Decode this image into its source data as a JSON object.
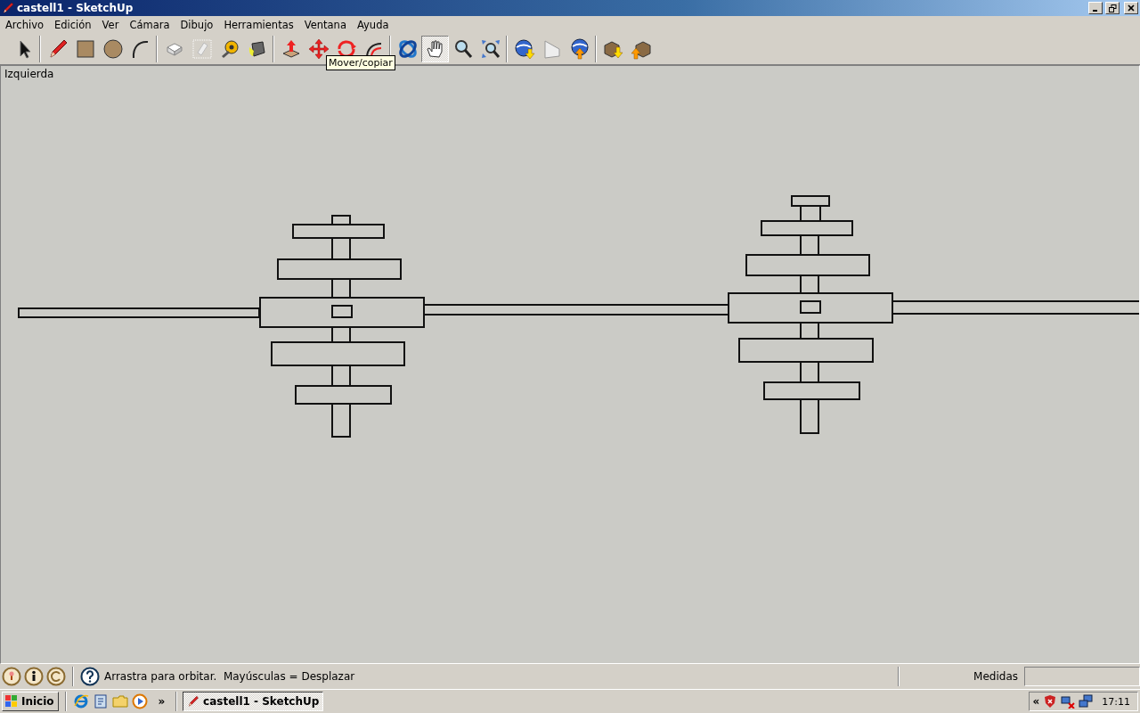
{
  "window": {
    "title": "castell1 - SketchUp"
  },
  "menu": [
    "Archivo",
    "Edición",
    "Ver",
    "Cámara",
    "Dibujo",
    "Herramientas",
    "Ventana",
    "Ayuda"
  ],
  "toolbar": {
    "groups": [
      [
        {
          "kind": "select",
          "selected": false
        }
      ],
      [
        {
          "kind": "pencil",
          "selected": false
        },
        {
          "kind": "rectangle",
          "selected": false
        },
        {
          "kind": "circle",
          "selected": false
        },
        {
          "kind": "arc",
          "selected": false
        }
      ],
      [
        {
          "kind": "cube",
          "selected": false
        },
        {
          "kind": "eraser",
          "selected": false
        },
        {
          "kind": "tape",
          "selected": false
        },
        {
          "kind": "paint",
          "selected": false
        }
      ],
      [
        {
          "kind": "pushpull",
          "selected": false
        },
        {
          "kind": "move",
          "selected": false
        },
        {
          "kind": "rotate",
          "selected": false
        },
        {
          "kind": "offset",
          "selected": false
        }
      ],
      [
        {
          "kind": "orbit",
          "selected": false
        },
        {
          "kind": "pan",
          "selected": true
        },
        {
          "kind": "zoom",
          "selected": false
        },
        {
          "kind": "zoomext",
          "selected": false
        }
      ],
      [
        {
          "kind": "globeget",
          "selected": false
        },
        {
          "kind": "photo",
          "selected": false
        },
        {
          "kind": "globeput",
          "selected": false
        }
      ],
      [
        {
          "kind": "boxget",
          "selected": false
        },
        {
          "kind": "boxput",
          "selected": false
        }
      ]
    ]
  },
  "tooltip": "Mover/copiar",
  "canvas": {
    "view_label": "Izquierda"
  },
  "status_bar": {
    "hint": "Arrastra para orbitar.  Mayúsculas = Desplazar",
    "measurements_label": "Medidas"
  },
  "taskbar": {
    "start": "Inicio",
    "overflow": "»",
    "tasks": [
      {
        "label": "castell1 - SketchUp",
        "selected": true
      }
    ],
    "tray_expand": "«",
    "clock": "17:11"
  }
}
